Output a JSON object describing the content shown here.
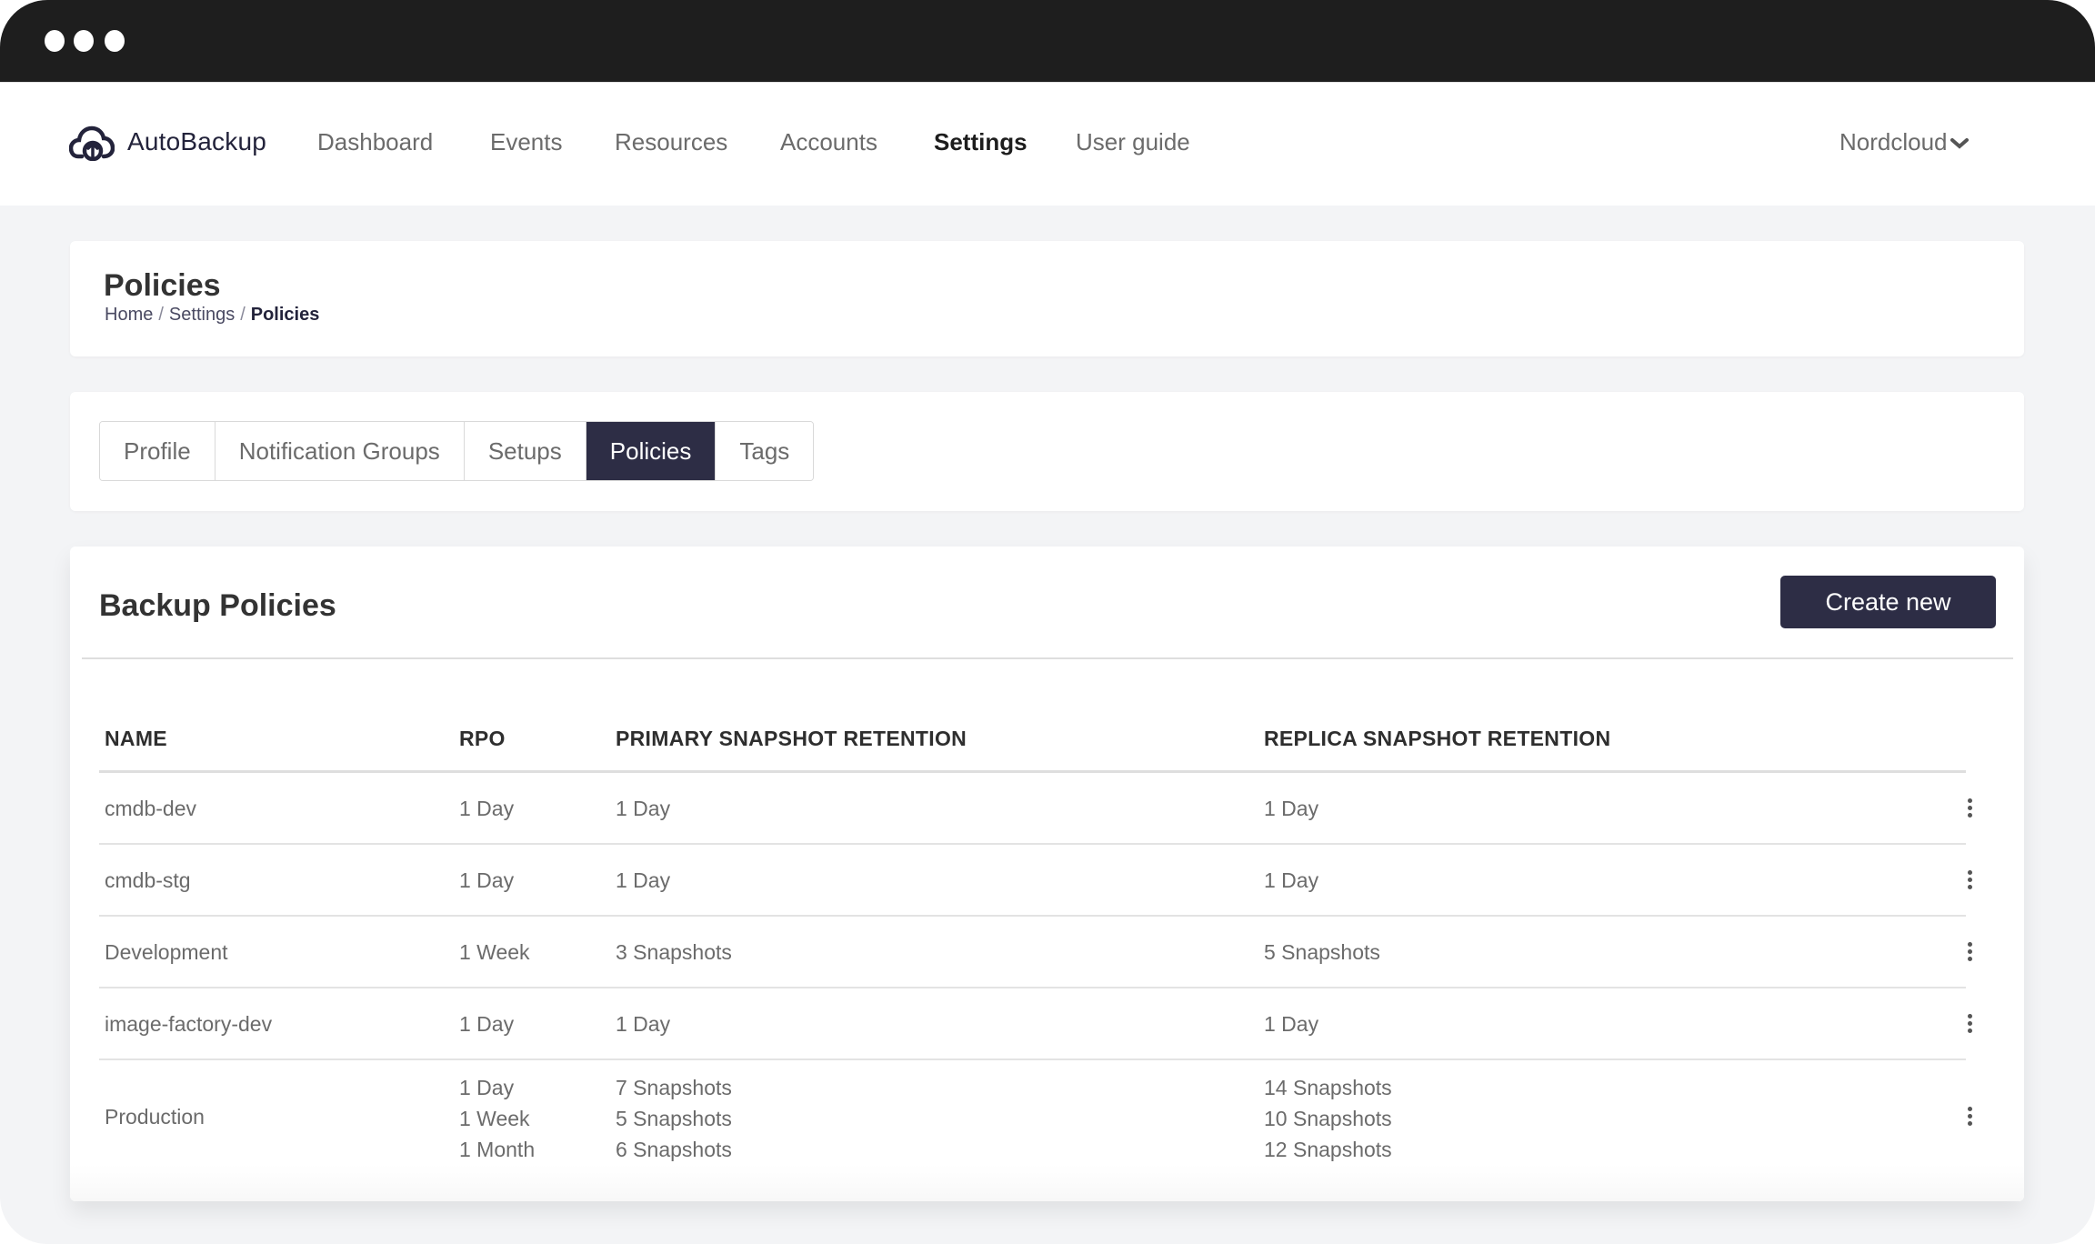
{
  "window": {
    "controls": [
      "dot",
      "dot",
      "dot"
    ]
  },
  "nav": {
    "brand": "AutoBackup",
    "links": [
      {
        "label": "Dashboard",
        "active": false
      },
      {
        "label": "Events",
        "active": false
      },
      {
        "label": "Resources",
        "active": false
      },
      {
        "label": "Accounts",
        "active": false
      },
      {
        "label": "Settings",
        "active": true
      },
      {
        "label": "User guide",
        "active": false
      }
    ],
    "account": "Nordcloud",
    "icons": {
      "logo": "cloud-upload-icon",
      "account_menu": "chevron-down-icon"
    }
  },
  "header": {
    "title": "Policies",
    "breadcrumb": [
      {
        "label": "Home"
      },
      {
        "label": "Settings"
      },
      {
        "label": "Policies"
      }
    ],
    "separator": "/"
  },
  "tabs": [
    {
      "label": "Profile",
      "active": false
    },
    {
      "label": "Notification Groups",
      "active": false
    },
    {
      "label": "Setups",
      "active": false
    },
    {
      "label": "Policies",
      "active": true
    },
    {
      "label": "Tags",
      "active": false
    }
  ],
  "policies": {
    "title": "Backup Policies",
    "create_label": "Create new",
    "columns": [
      "NAME",
      "RPO",
      "PRIMARY SNAPSHOT RETENTION",
      "REPLICA SNAPSHOT RETENTION"
    ],
    "rows": [
      {
        "name": "cmdb-dev",
        "rpo": [
          "1 Day"
        ],
        "primary": [
          "1 Day"
        ],
        "replica": [
          "1 Day"
        ]
      },
      {
        "name": "cmdb-stg",
        "rpo": [
          "1 Day"
        ],
        "primary": [
          "1 Day"
        ],
        "replica": [
          "1 Day"
        ]
      },
      {
        "name": "Development",
        "rpo": [
          "1 Week"
        ],
        "primary": [
          "3 Snapshots"
        ],
        "replica": [
          "5 Snapshots"
        ]
      },
      {
        "name": "image-factory-dev",
        "rpo": [
          "1 Day"
        ],
        "primary": [
          "1 Day"
        ],
        "replica": [
          "1 Day"
        ]
      },
      {
        "name": "Production",
        "rpo": [
          "1 Day",
          "1 Week",
          "1 Month"
        ],
        "primary": [
          "7 Snapshots",
          "5 Snapshots",
          "6 Snapshots"
        ],
        "replica": [
          "14 Snapshots",
          "10 Snapshots",
          "12 Snapshots"
        ]
      }
    ],
    "row_action_icon": "kebab-menu-icon"
  }
}
